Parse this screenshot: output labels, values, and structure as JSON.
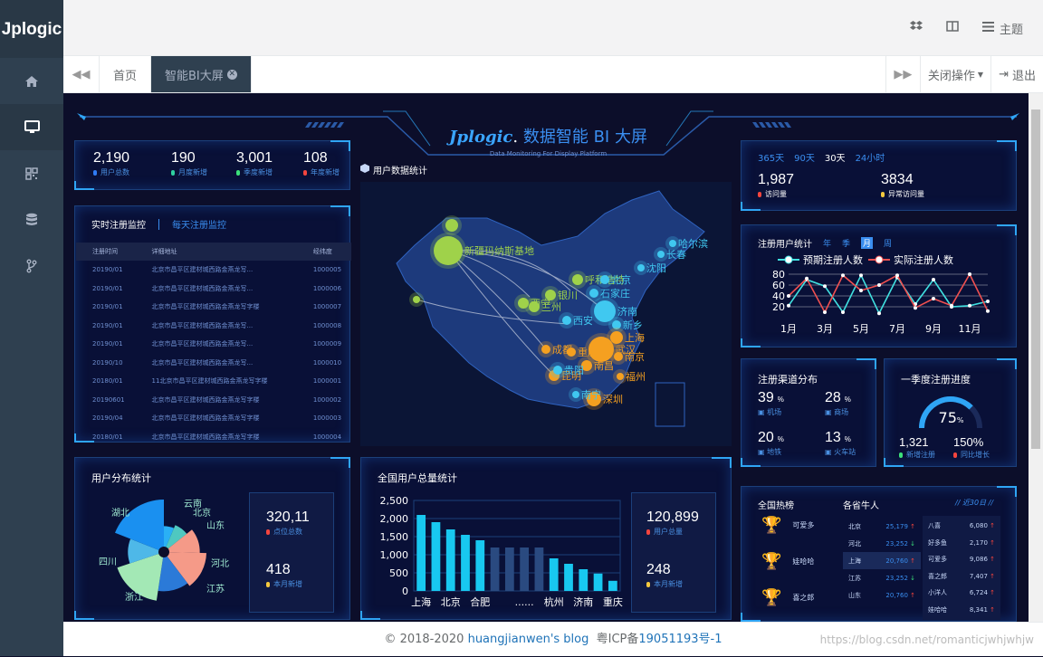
{
  "app": {
    "logo": "Jplogic"
  },
  "topbar": {
    "theme_label": "主题"
  },
  "tabs": {
    "home": "首页",
    "bi": "智能BI大屏",
    "close_ops": "关闭操作",
    "logout": "退出"
  },
  "dashboard": {
    "title_brand": "Jplogic",
    "title_dot": ".",
    "title_cn": "数据智能 BI 大屏",
    "subtitle": "Data Monitoring For Display Platform",
    "user_stats": [
      {
        "value": "2,190",
        "label": "用户总数",
        "color": "#2f7bf5"
      },
      {
        "value": "190",
        "label": "月度新增",
        "color": "#2fd0a0"
      },
      {
        "value": "3,001",
        "label": "季度新增",
        "color": "#3ce07a"
      },
      {
        "value": "108",
        "label": "年度新增",
        "color": "#f5453e"
      }
    ],
    "monitor": {
      "tab_active": "实时注册监控",
      "tab_other": "每天注册监控",
      "columns": [
        "注册时间",
        "详细地址",
        "经纬度"
      ],
      "rows": [
        [
          "20190/01",
          "北京市昌平区建材城西路金燕龙写...",
          "1000005"
        ],
        [
          "20190/01",
          "北京市昌平区建材城西路金燕龙写...",
          "1000006"
        ],
        [
          "20190/01",
          "北京市昌平区建材城西路金燕龙写字楼",
          "1000007"
        ],
        [
          "20190/01",
          "北京市昌平区建材城西路金燕龙写...",
          "1000008"
        ],
        [
          "20190/01",
          "北京市昌平区建材城西路金燕龙写...",
          "1000009"
        ],
        [
          "20190/10",
          "北京市昌平区建材城西路金燕龙写...",
          "1000010"
        ],
        [
          "20180/01",
          "11北京市昌平区建材城西路金燕龙写字楼",
          "1000001"
        ],
        [
          "20190601",
          "北京市昌平区建材城西路金燕龙写字楼",
          "1000002"
        ],
        [
          "20190/04",
          "北京市昌平区建材城西路金燕龙写字楼",
          "1000003"
        ],
        [
          "20180/01",
          "北京市昌平区建材城西路金燕龙写字楼",
          "1000004"
        ]
      ]
    },
    "map": {
      "title": "用户数据统计"
    },
    "visits": {
      "ranges": [
        "365天",
        "90天",
        "30天",
        "24小时"
      ],
      "active_range": "30天",
      "visit_value": "1,987",
      "visit_label": "访问量",
      "abnormal_value": "3834",
      "abnormal_label": "异常访问量"
    },
    "register": {
      "title": "注册用户统计",
      "periods": [
        "年",
        "季",
        "月",
        "周"
      ],
      "active_period": "月"
    },
    "channels": {
      "title": "注册渠道分布",
      "items": [
        {
          "value": "39",
          "unit": "%",
          "label": "机场"
        },
        {
          "value": "28",
          "unit": "%",
          "label": "商场"
        },
        {
          "value": "20",
          "unit": "%",
          "label": "地铁"
        },
        {
          "value": "13",
          "unit": "%",
          "label": "火车站"
        }
      ]
    },
    "progress": {
      "title": "一季度注册进度",
      "percent": "75",
      "unit": "%",
      "fraction": 0.75,
      "new_value": "1,321",
      "new_label": "新增注册",
      "growth_value": "150%",
      "growth_label": "同比增长"
    },
    "distribution": {
      "title": "用户分布统计",
      "total_value": "320,11",
      "total_label": "点位总数",
      "month_value": "418",
      "month_label": "本月新增"
    },
    "national": {
      "title": "全国用户总量统计",
      "total_value": "120,899",
      "total_label": "用户总量",
      "month_value": "248",
      "month_label": "本月新增"
    },
    "rank": {
      "hot_title": "全国热榜",
      "province_title": "各省牛人",
      "recent": "// 近30日 //",
      "hot": [
        "可爱多",
        "娃哈哈",
        "喜之郎"
      ],
      "provinces": [
        {
          "name": "北京",
          "value": "25,179",
          "up": true
        },
        {
          "name": "河北",
          "value": "23,252",
          "up": false
        },
        {
          "name": "上海",
          "value": "20,760",
          "up": true
        },
        {
          "name": "江苏",
          "value": "23,252",
          "up": false
        },
        {
          "name": "山东",
          "value": "20,760",
          "up": true
        }
      ],
      "people": [
        {
          "name": "八喜",
          "value": "6,080",
          "up": true
        },
        {
          "name": "好多鱼",
          "value": "2,170",
          "up": true
        },
        {
          "name": "可爱多",
          "value": "9,086",
          "up": true
        },
        {
          "name": "喜之郎",
          "value": "7,407",
          "up": true
        },
        {
          "name": "小洋人",
          "value": "6,724",
          "up": true
        },
        {
          "name": "娃哈哈",
          "value": "8,341",
          "up": true
        }
      ]
    }
  },
  "chart_data": [
    {
      "type": "line",
      "title": "注册用户统计",
      "categories": [
        "1月",
        "2月",
        "3月",
        "4月",
        "5月",
        "6月",
        "7月",
        "8月",
        "9月",
        "10月",
        "11月",
        "12月"
      ],
      "ylim": [
        0,
        100
      ],
      "yticks": [
        20,
        40,
        60,
        80
      ],
      "xticks": [
        "1月",
        "3月",
        "5月",
        "7月",
        "9月",
        "11月"
      ],
      "series": [
        {
          "name": "预期注册人数",
          "color": "#40e0e0",
          "values": [
            22,
            70,
            58,
            10,
            78,
            8,
            74,
            25,
            70,
            20,
            22,
            30
          ]
        },
        {
          "name": "实际注册人数",
          "color": "#f05050",
          "values": [
            40,
            72,
            10,
            78,
            50,
            60,
            78,
            18,
            35,
            22,
            80,
            12
          ]
        }
      ]
    },
    {
      "type": "pie",
      "title": "用户分布统计",
      "categories": [
        "云南",
        "北京",
        "山东",
        "河北",
        "江苏",
        "浙江",
        "四川",
        "湖北"
      ],
      "values": [
        8,
        10,
        14,
        18,
        16,
        22,
        14,
        24
      ],
      "colors": [
        "#2ab0f5",
        "#4fc8c0",
        "#f59a88",
        "#f59a88",
        "#2b7ad8",
        "#a3e8b5",
        "#4eb8e8",
        "#1a90f0"
      ]
    },
    {
      "type": "bar",
      "title": "全国用户总量统计",
      "categories": [
        "上海",
        "",
        "北京",
        "",
        "合肥",
        "",
        "",
        "......",
        "",
        "杭州",
        "",
        "济南",
        "",
        "重庆"
      ],
      "xticks": [
        "上海",
        "北京",
        "合肥",
        "......",
        "杭州",
        "济南",
        "重庆"
      ],
      "values": [
        2100,
        1900,
        1700,
        1550,
        1400,
        1200,
        1200,
        1200,
        1200,
        900,
        750,
        600,
        480,
        280
      ],
      "yticks": [
        "0",
        "500",
        "1,000",
        "1,500",
        "2,000",
        "2,500"
      ],
      "ylim": [
        0,
        2500
      ]
    }
  ]
}
